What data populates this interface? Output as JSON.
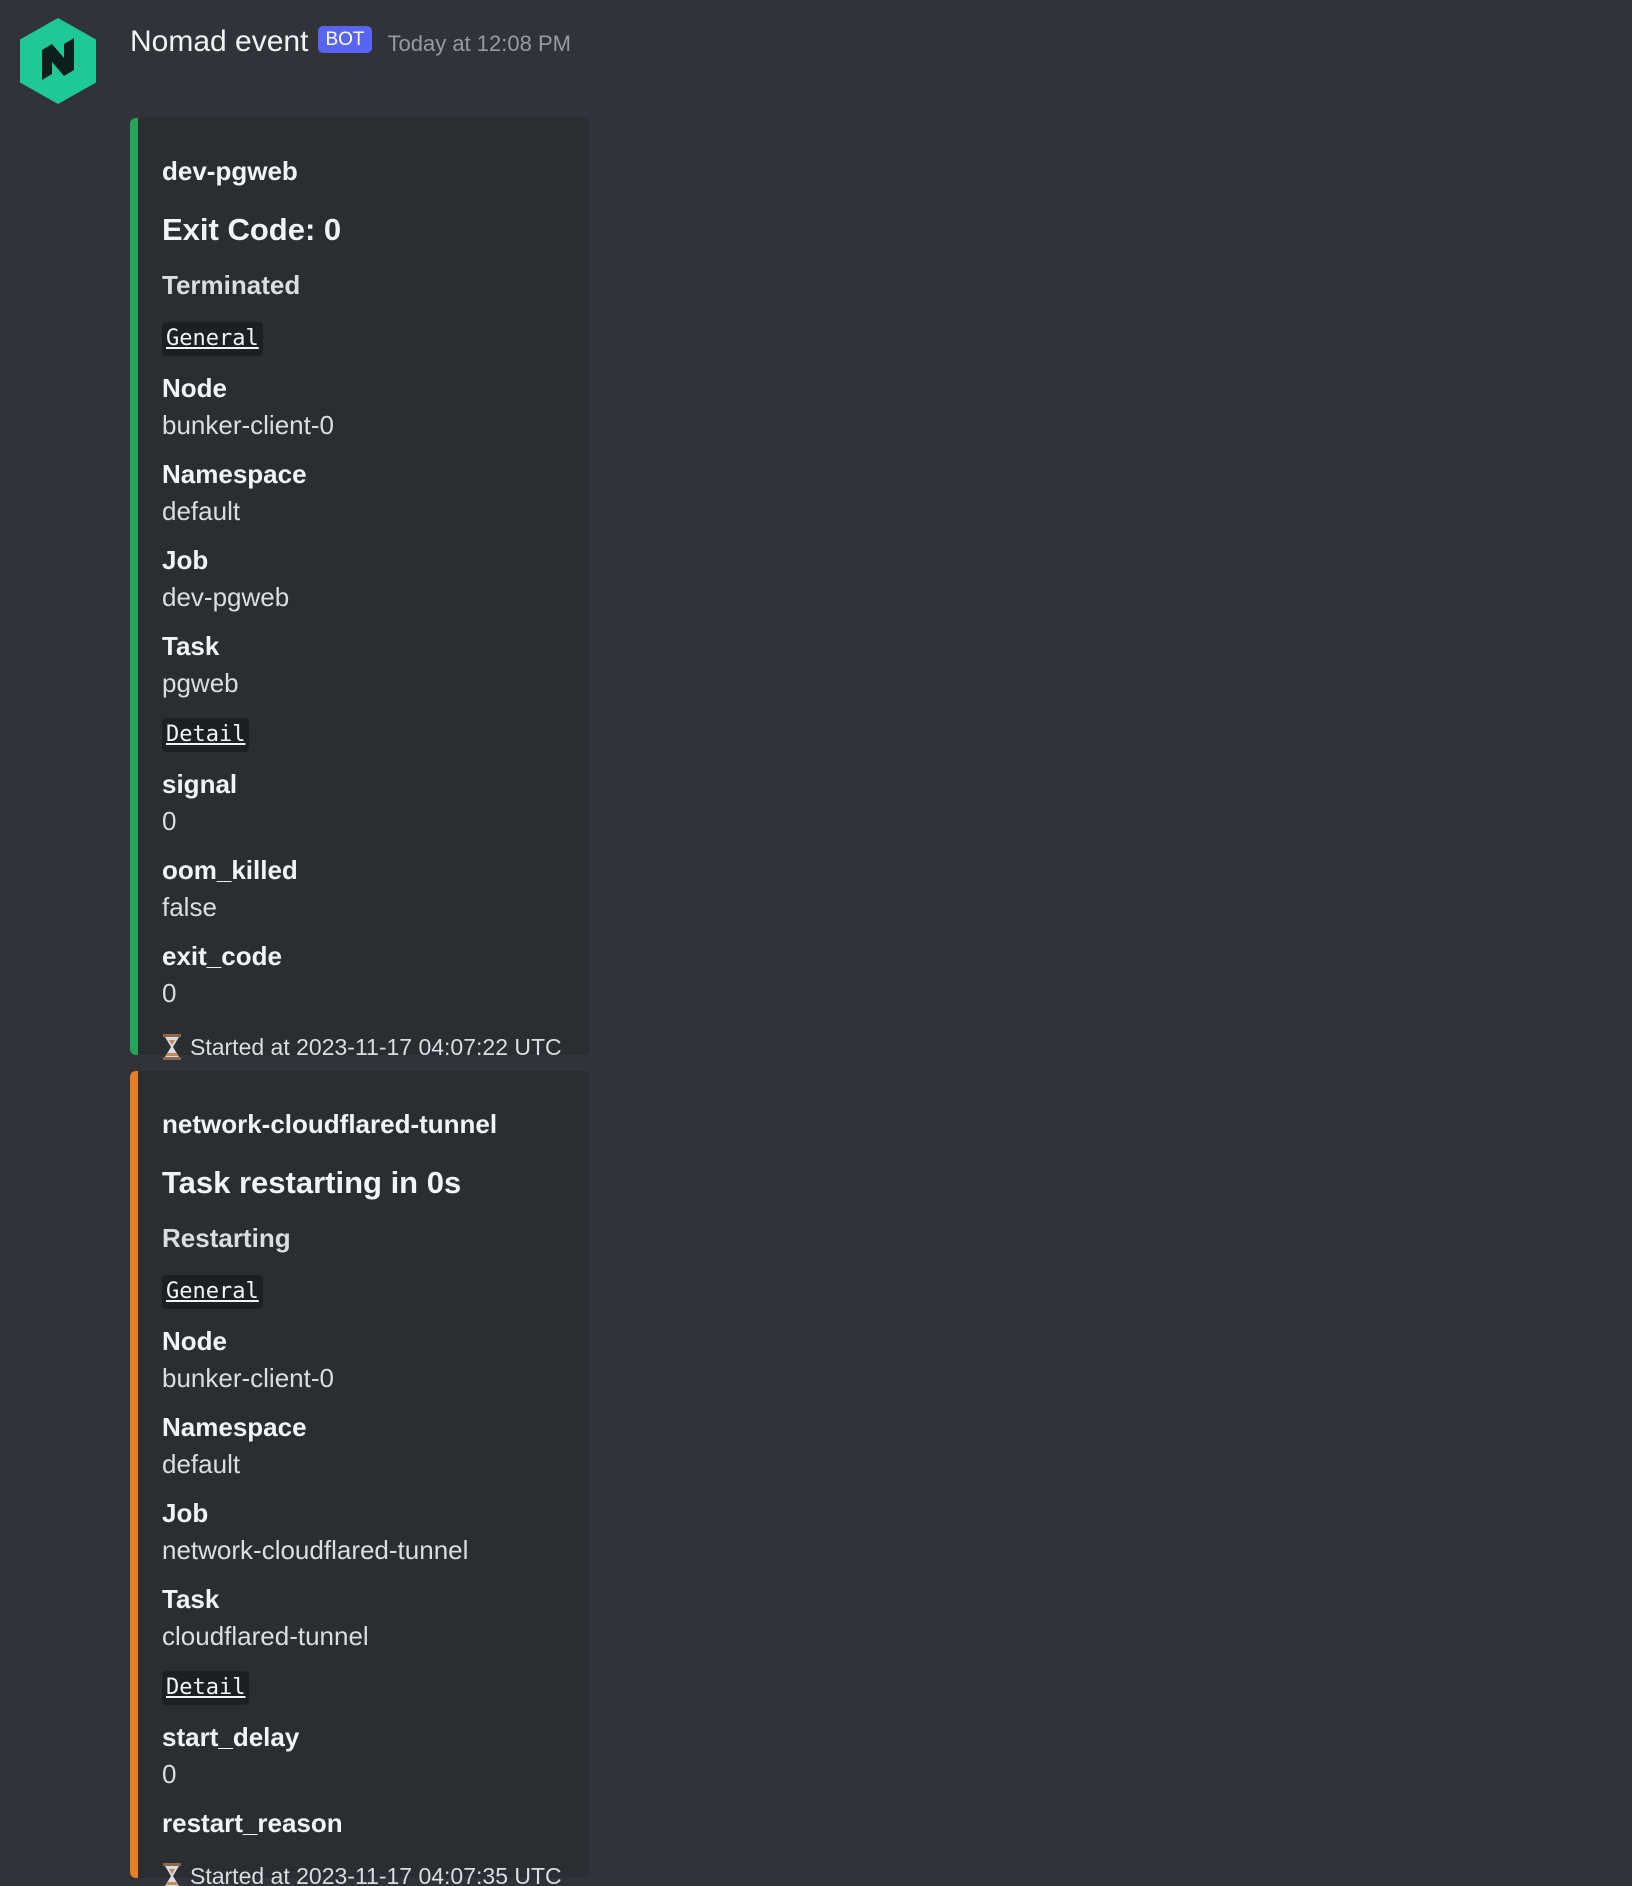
{
  "message": {
    "username": "Nomad event",
    "badge": "BOT",
    "timestamp": "Today at 12:08 PM",
    "avatar_icon": "nomad-logo-icon",
    "colors": {
      "avatar": "#1fc995",
      "badge": "#5865f2",
      "embed1_border": "#23a55a",
      "embed2_border": "#e67e22"
    }
  },
  "embeds": [
    {
      "author": "dev-pgweb",
      "title": "Exit Code: 0",
      "status": "Terminated",
      "general_label": "General",
      "node_name": "Node",
      "node_value": "bunker-client-0",
      "namespace_name": "Namespace",
      "namespace_value": "default",
      "job_name": "Job",
      "job_value": "dev-pgweb",
      "task_name": "Task",
      "task_value": "pgweb",
      "detail_label": "Detail",
      "details": [
        {
          "name": "signal",
          "value": "0"
        },
        {
          "name": "oom_killed",
          "value": "false"
        },
        {
          "name": "exit_code",
          "value": "0"
        }
      ],
      "footer": "Started at 2023-11-17 04:07:22 UTC"
    },
    {
      "author": "network-cloudflared-tunnel",
      "title": "Task restarting in 0s",
      "status": "Restarting",
      "general_label": "General",
      "node_name": "Node",
      "node_value": "bunker-client-0",
      "namespace_name": "Namespace",
      "namespace_value": "default",
      "job_name": "Job",
      "job_value": "network-cloudflared-tunnel",
      "task_name": "Task",
      "task_value": "cloudflared-tunnel",
      "detail_label": "Detail",
      "details": [
        {
          "name": "start_delay",
          "value": "0"
        },
        {
          "name": "restart_reason",
          "value": ""
        }
      ],
      "footer": "Started at 2023-11-17 04:07:35 UTC"
    }
  ]
}
